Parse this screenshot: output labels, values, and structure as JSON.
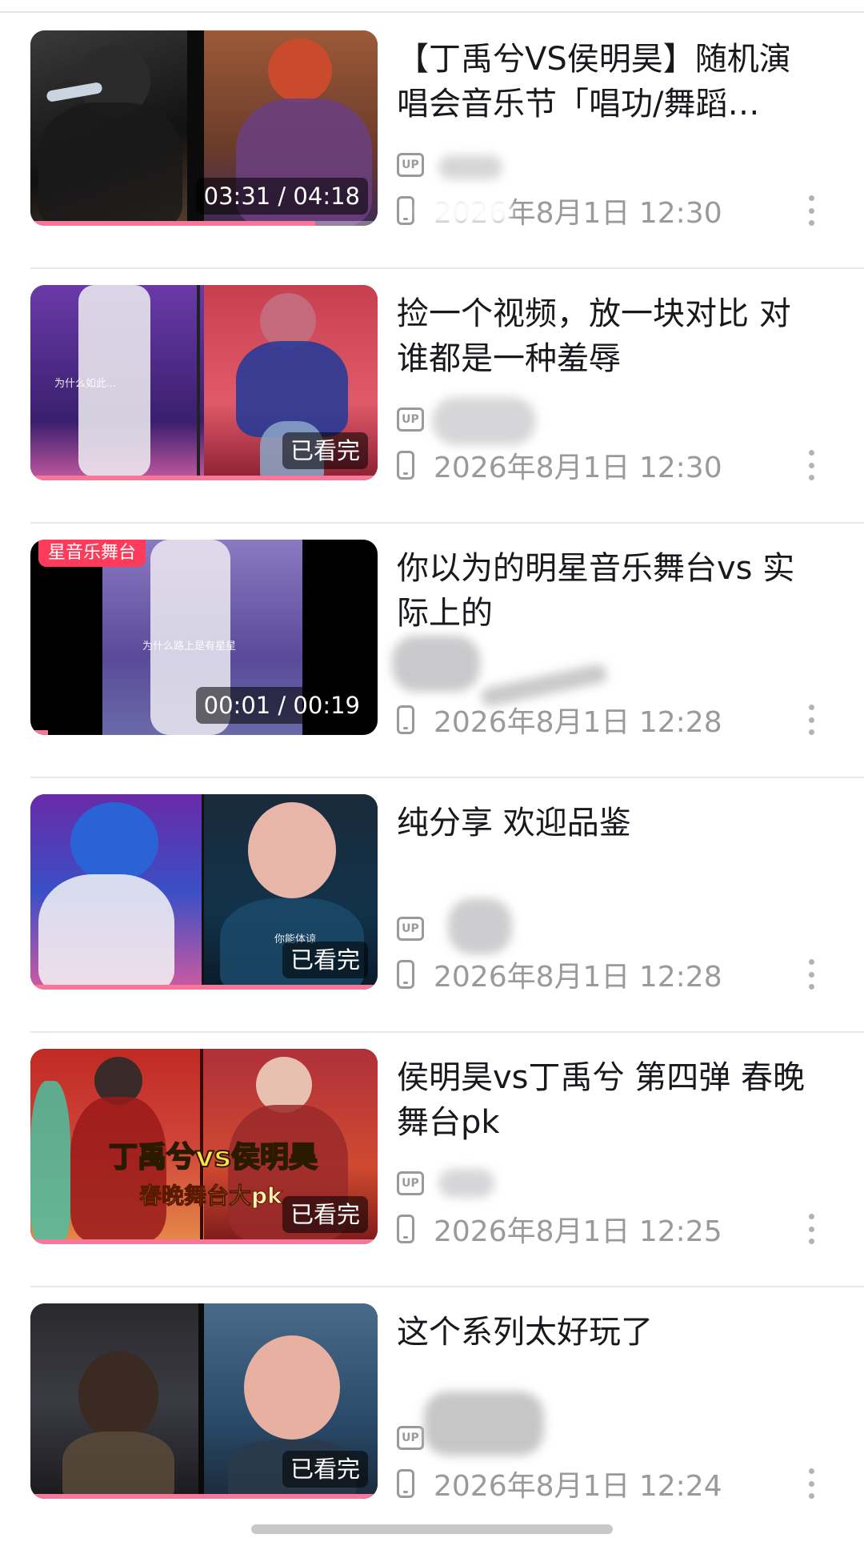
{
  "videos": [
    {
      "title": "【丁禹兮VS侯明昊】随机演唱会音乐节「唱功/舞蹈…",
      "badge": "03:31 / 04:18",
      "uploader_icon": "UP",
      "date": "2026年8月1日 12:30",
      "progress": 0.82,
      "thumb_colors": [
        "#1b1b1b",
        "#8a4d33"
      ]
    },
    {
      "title": "捡一个视频，放一块对比 对谁都是一种羞辱",
      "badge": "已看完",
      "overlay": "为什么如此...",
      "uploader_icon": "UP",
      "date": "2026年8月1日 12:30",
      "progress": 1.0,
      "thumb_colors": [
        "#4a2a7a",
        "#c03550"
      ]
    },
    {
      "title": "你以为的明星音乐舞台vs 实际上的",
      "badge": "00:01 / 00:19",
      "tag": "星音乐舞台",
      "overlay": "为什么路上是有星星",
      "uploader_icon": "UP",
      "date": "2026年8月1日 12:28",
      "progress": 0.05,
      "thumb_colors": [
        "#000000",
        "#7a6ab2"
      ]
    },
    {
      "title": "纯分享 欢迎品鉴",
      "badge": "已看完",
      "overlay": "你能体谅",
      "uploader_icon": "UP",
      "date": "2026年8月1日 12:28",
      "progress": 1.0,
      "thumb_colors": [
        "#3a4fb5",
        "#1c3a55"
      ]
    },
    {
      "title": "侯明昊vs丁禹兮 第四弹 春晚舞台pk",
      "badge": "已看完",
      "caption_main": "丁禹兮vs侯明昊",
      "caption_sub": "春晚舞台大pk",
      "uploader_icon": "UP",
      "date": "2026年8月1日 12:25",
      "progress": 1.0,
      "thumb_colors": [
        "#b3261e",
        "#c4422b"
      ]
    },
    {
      "title": "这个系列太好玩了",
      "badge": "已看完",
      "uploader_icon": "UP",
      "date": "2026年8月1日 12:24",
      "progress": 1.0,
      "thumb_colors": [
        "#2a2a2e",
        "#4f6f8a"
      ]
    }
  ]
}
